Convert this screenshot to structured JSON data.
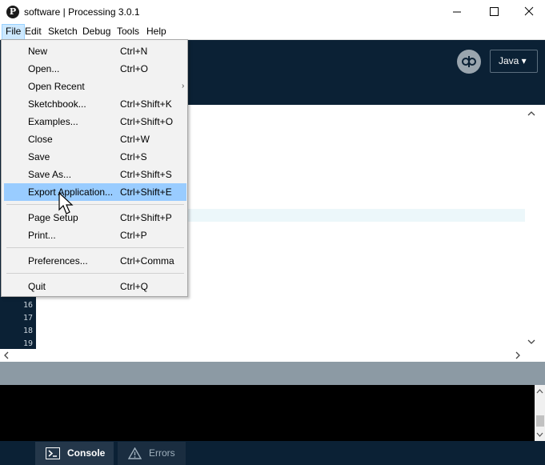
{
  "window": {
    "title": "software | Processing 3.0.1",
    "logo_glyph": "P"
  },
  "menubar": {
    "items": [
      "File",
      "Edit",
      "Sketch",
      "Debug",
      "Tools",
      "Help"
    ]
  },
  "toolbar": {
    "mode_label": "Java ▾"
  },
  "file_menu": {
    "items": [
      {
        "label": "New",
        "shortcut": "Ctrl+N"
      },
      {
        "label": "Open...",
        "shortcut": "Ctrl+O"
      },
      {
        "label": "Open Recent",
        "shortcut": ""
      },
      {
        "label": "Sketchbook...",
        "shortcut": "Ctrl+Shift+K"
      },
      {
        "label": "Examples...",
        "shortcut": "Ctrl+Shift+O"
      },
      {
        "label": "Close",
        "shortcut": "Ctrl+W"
      },
      {
        "label": "Save",
        "shortcut": "Ctrl+S"
      },
      {
        "label": "Save As...",
        "shortcut": "Ctrl+Shift+S"
      },
      {
        "label": "Export Application...",
        "shortcut": "Ctrl+Shift+E"
      },
      {
        "label": "Page Setup",
        "shortcut": "Ctrl+Shift+P"
      },
      {
        "label": "Print...",
        "shortcut": "Ctrl+P"
      },
      {
        "label": "Preferences...",
        "shortcut": "Ctrl+Comma"
      },
      {
        "label": "Quit",
        "shortcut": "Ctrl+Q"
      }
    ],
    "highlighted": "Export Application...",
    "submenu_arrow": "›"
  },
  "editor": {
    "line_numbers": [
      "16",
      "17",
      "18",
      "19"
    ]
  },
  "footer": {
    "console_label": "Console",
    "errors_label": "Errors"
  },
  "colors": {
    "toolbar_bg": "#0b2135",
    "menu_highlight": "#99ccff",
    "status_bar": "#8c9aa4"
  },
  "icons": [
    "processing-logo-icon",
    "minimize-icon",
    "maximize-icon",
    "close-icon",
    "debug-mode-icon",
    "console-icon",
    "warning-icon",
    "mouse-cursor-icon",
    "submenu-arrow-icon"
  ]
}
